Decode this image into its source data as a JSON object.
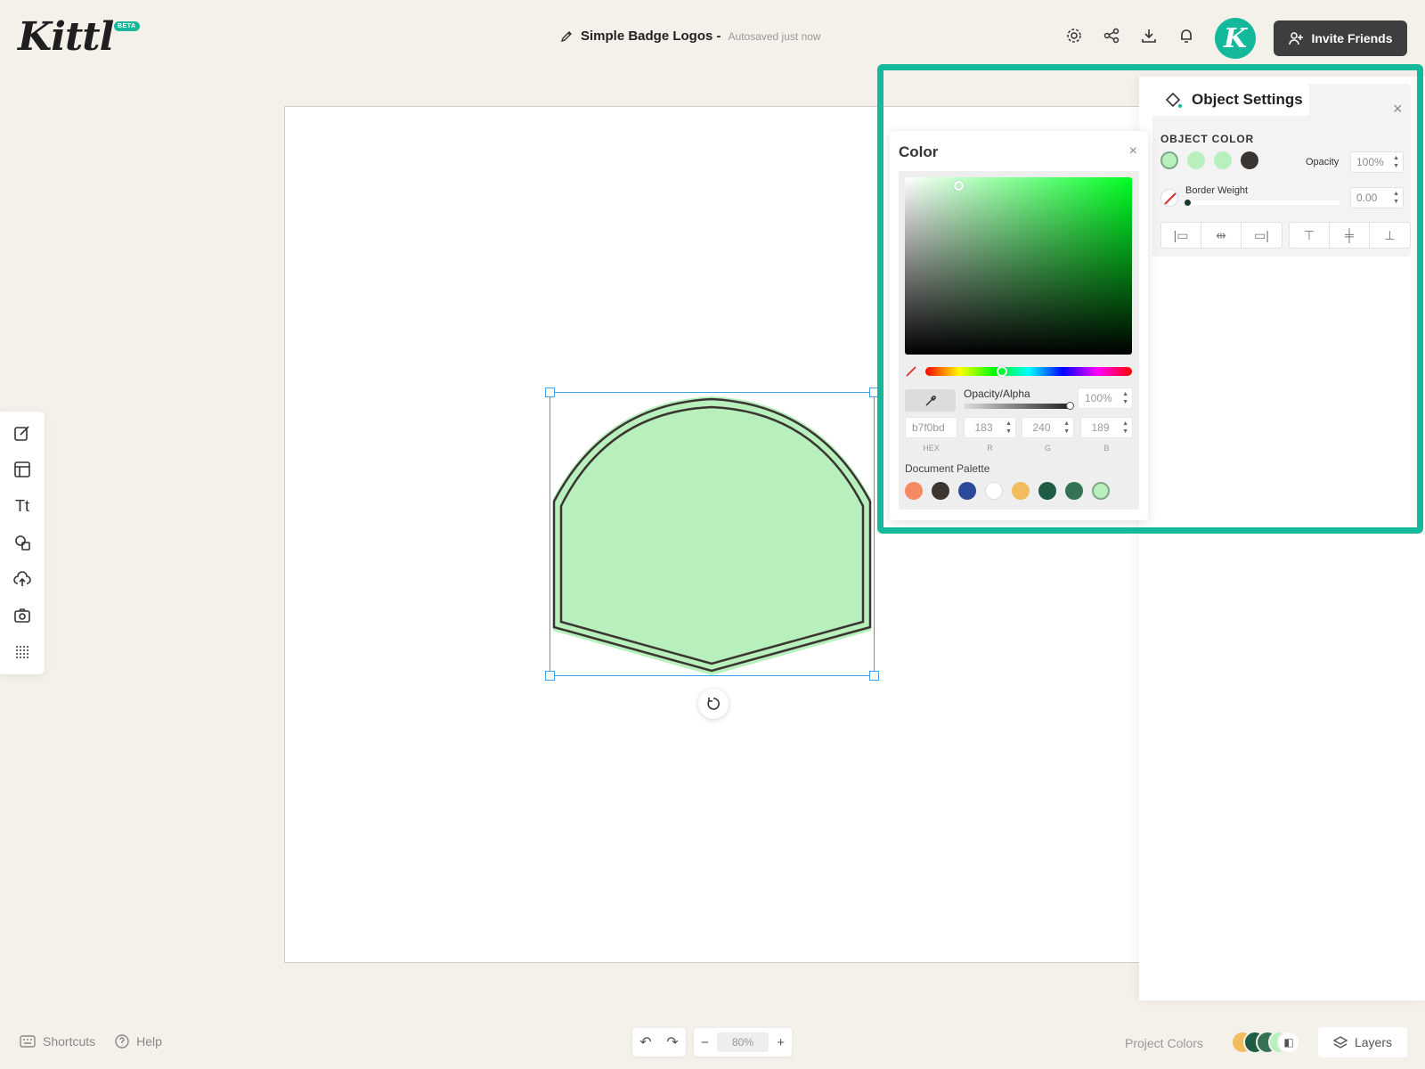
{
  "app": {
    "logo_text": "Kittl",
    "beta_badge": "BETA"
  },
  "header": {
    "doc_title": "Simple Badge Logos -",
    "autosave": "Autosaved just now",
    "icons": [
      "settings-icon",
      "share-icon",
      "download-icon",
      "bell-icon"
    ],
    "avatar_letter": "K",
    "invite_label": "Invite Friends"
  },
  "toolbar": {
    "tools": [
      "edit-icon",
      "templates-icon",
      "text-icon",
      "shapes-icon",
      "upload-icon",
      "camera-icon",
      "pattern-icon"
    ],
    "text_tool_glyph": "Tt"
  },
  "object_settings": {
    "title": "Object Settings",
    "object_color_label": "OBJECT COLOR",
    "swatches": [
      "#b7f0bd",
      "#b7f0bd",
      "#b7f0bd",
      "#3b3532"
    ],
    "opacity_label": "Opacity",
    "opacity_value": "100%",
    "border_weight_label": "Border Weight",
    "border_weight_value": "0.00",
    "align_buttons": [
      "align-left-icon",
      "align-center-h-icon",
      "align-right-icon",
      "align-top-icon",
      "align-center-v-icon",
      "align-bottom-icon"
    ]
  },
  "color_popup": {
    "title": "Color",
    "opacity_label": "Opacity/Alpha",
    "opacity_value": "100%",
    "hex_value": "b7f0bd",
    "r": "183",
    "g": "240",
    "b": "189",
    "hex_caption": "HEX",
    "r_caption": "R",
    "g_caption": "G",
    "b_caption": "B",
    "palette_label": "Document Palette",
    "palette": [
      "#f58a63",
      "#3b3532",
      "#2b4a9a",
      "#ffffff",
      "#f2bd5e",
      "#1e5c44",
      "#357153",
      "#b7f0bd"
    ]
  },
  "footer": {
    "shortcuts_label": "Shortcuts",
    "help_label": "Help",
    "zoom_value": "80%",
    "zoom_minus": "−",
    "zoom_plus": "+",
    "project_colors_label": "Project Colors",
    "project_colors": [
      "#f2bd5e",
      "#1e5c44",
      "#357153",
      "#b7f0bd"
    ],
    "layers_label": "Layers"
  },
  "badge": {
    "fill": "#b7f0bd",
    "stroke": "#3b3532"
  }
}
